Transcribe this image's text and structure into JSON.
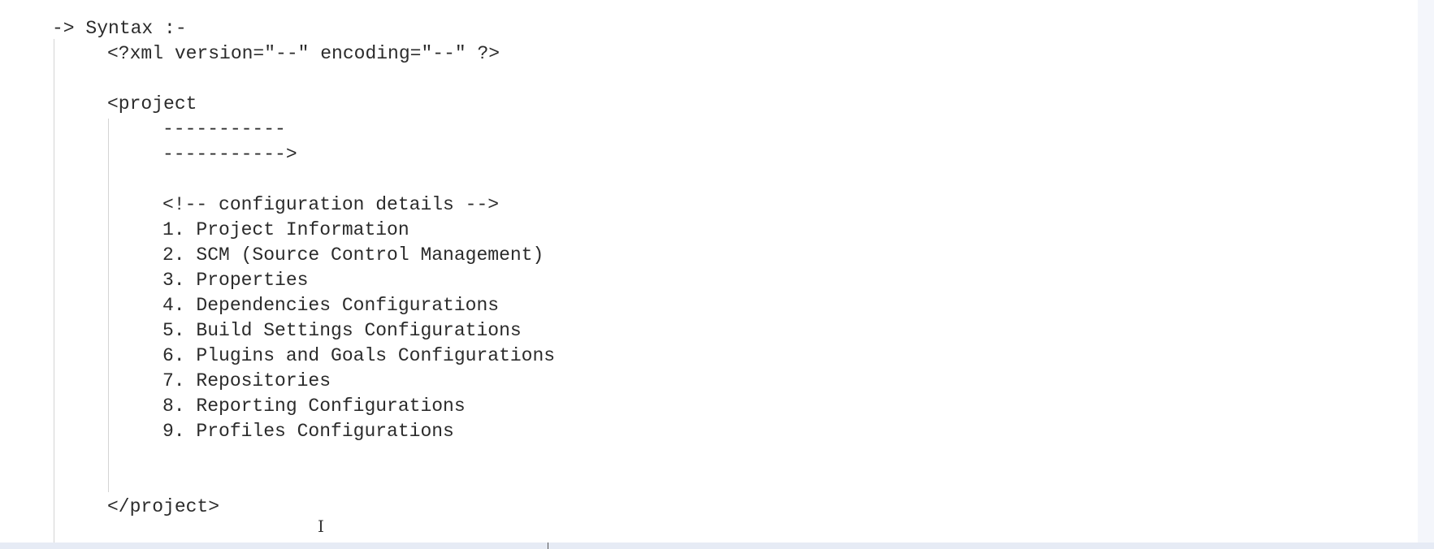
{
  "document": {
    "heading": "-> Syntax :-",
    "xml_declaration": "<?xml version=\"--\" encoding=\"--\" ?>",
    "project_open": "<project",
    "attr_line_1": "-----------",
    "attr_line_2": "----------->",
    "comment": "<!-- configuration details -->",
    "items": [
      "1. Project Information",
      "2. SCM (Source Control Management)",
      "3. Properties",
      "4. Dependencies Configurations",
      "5. Build Settings Configurations",
      "6. Plugins and Goals Configurations",
      "7. Repositories",
      "8. Reporting Configurations",
      "9. Profiles Configurations"
    ],
    "project_close": "</project>"
  },
  "icons": {
    "cursor": "text-cursor-icon",
    "cursor_glyph": "I"
  }
}
